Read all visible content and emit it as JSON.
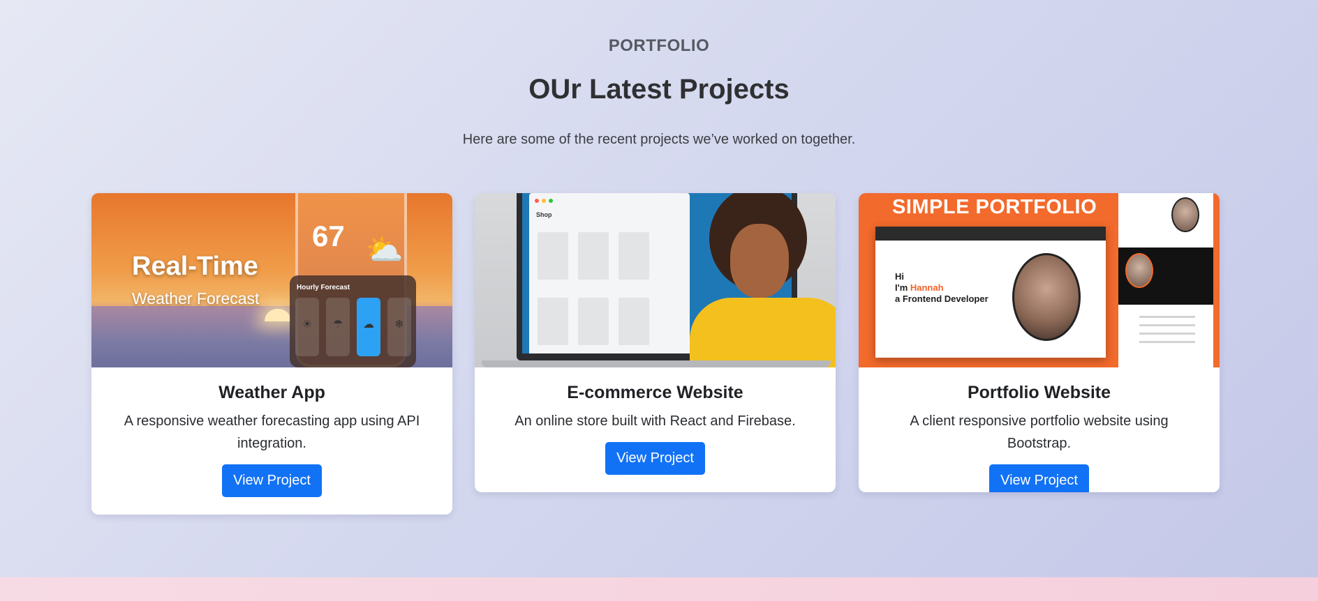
{
  "section": {
    "eyebrow": "PORTFOLIO",
    "title": "OUr Latest Projects",
    "subtitle": "Here are some of the recent projects we’ve worked on together."
  },
  "projects": [
    {
      "title": "Weather App",
      "description": "A responsive weather forecasting app using API integration.",
      "button_label": "View Project",
      "thumbnail": {
        "headline": "Real-Time",
        "subheadline": "Weather Forecast",
        "temperature": "67",
        "panel_title": "Hourly Forecast"
      }
    },
    {
      "title": "E-commerce Website",
      "description": "An online store built with React and Firebase.",
      "button_label": "View Project",
      "thumbnail": {
        "shop_label": "Shop"
      }
    },
    {
      "title": "Portfolio Website",
      "description": "A client responsive portfolio website using Bootstrap.",
      "button_label": "View Project",
      "thumbnail": {
        "headline": "SIMPLE PORTFOLIO",
        "greeting_line_1": "Hi",
        "greeting_line_2a": "I'm ",
        "greeting_name": "Hannah",
        "greeting_line_3": "a Frontend Developer"
      }
    }
  ],
  "colors": {
    "button": "#1272f5",
    "background_start": "#e6e8f4",
    "background_end": "#c4c8e8",
    "footer_strip": "#f7dbe4"
  },
  "icons": {
    "weather_thumb_cloud": "sun-cloud-icon"
  }
}
